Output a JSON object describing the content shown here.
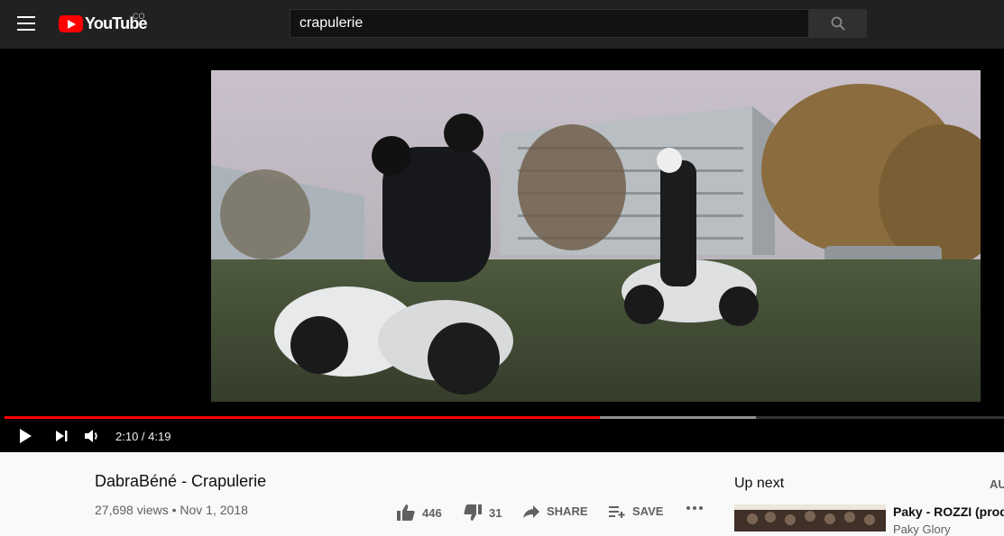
{
  "header": {
    "logo_text": "YouTube",
    "country_code": "CO",
    "search_value": "crapulerie"
  },
  "player": {
    "time_display": "2:10 / 4:19",
    "progress_fraction": 0.596,
    "buffered_fraction": 0.752,
    "icons": [
      "play-icon",
      "next-icon",
      "volume-icon"
    ]
  },
  "video": {
    "title": "DabraBéné - Crapulerie",
    "views_date": "27,698 views • Nov 1, 2018",
    "likes": "446",
    "dislikes": "31",
    "share_label": "SHARE",
    "save_label": "SAVE"
  },
  "sidebar": {
    "up_next_label": "Up next",
    "autoplay_label": "AU",
    "recommendation": {
      "title": "Paky - ROZZI (prod.",
      "channel": "Paky Glory"
    }
  },
  "colors": {
    "topbar": "#212121",
    "brand_red": "#ff0000",
    "progress_red": "#ff0000",
    "page_bg": "#f9f9f9"
  }
}
